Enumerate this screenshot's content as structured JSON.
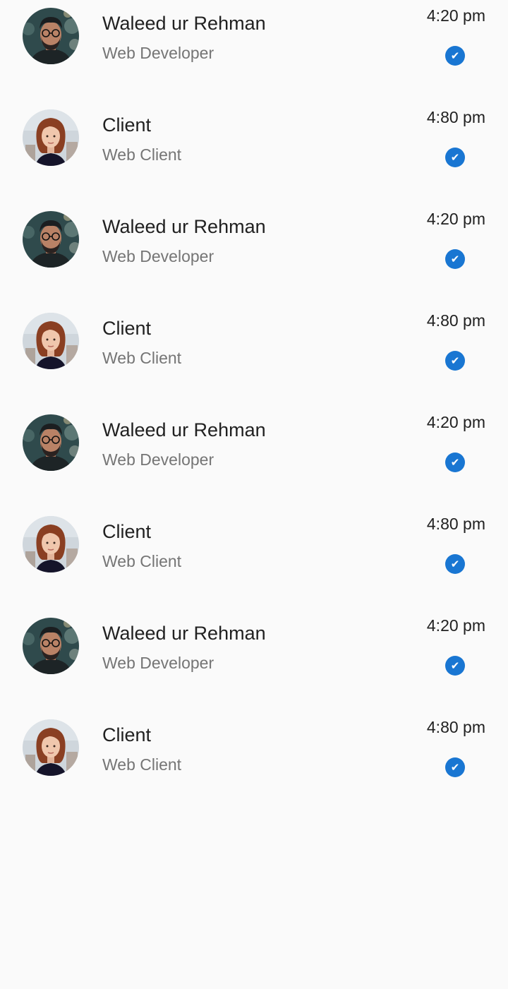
{
  "colors": {
    "background": "#fafafa",
    "primary_text": "#212121",
    "secondary_text": "#757575",
    "check_badge": "#1976d2"
  },
  "contacts": [
    {
      "name": "Waleed ur Rehman",
      "role": "Web Developer",
      "time": "4:20 pm",
      "avatar": "man-avatar",
      "status_icon": "check-circle-icon"
    },
    {
      "name": "Client",
      "role": "Web Client",
      "time": "4:80 pm",
      "avatar": "woman-avatar",
      "status_icon": "check-circle-icon"
    },
    {
      "name": "Waleed ur Rehman",
      "role": "Web Developer",
      "time": "4:20 pm",
      "avatar": "man-avatar",
      "status_icon": "check-circle-icon"
    },
    {
      "name": "Client",
      "role": "Web Client",
      "time": "4:80 pm",
      "avatar": "woman-avatar",
      "status_icon": "check-circle-icon"
    },
    {
      "name": "Waleed ur Rehman",
      "role": "Web Developer",
      "time": "4:20 pm",
      "avatar": "man-avatar",
      "status_icon": "check-circle-icon"
    },
    {
      "name": "Client",
      "role": "Web Client",
      "time": "4:80 pm",
      "avatar": "woman-avatar",
      "status_icon": "check-circle-icon"
    },
    {
      "name": "Waleed ur Rehman",
      "role": "Web Developer",
      "time": "4:20 pm",
      "avatar": "man-avatar",
      "status_icon": "check-circle-icon"
    },
    {
      "name": "Client",
      "role": "Web Client",
      "time": "4:80 pm",
      "avatar": "woman-avatar",
      "status_icon": "check-circle-icon"
    }
  ]
}
